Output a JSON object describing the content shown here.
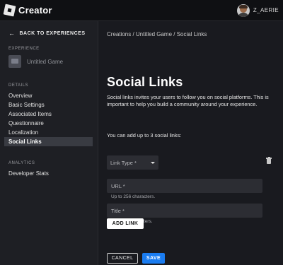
{
  "topbar": {
    "app_name": "Creator",
    "username": "Z_AERIE"
  },
  "sidebar": {
    "back_label": "BACK TO EXPERIENCES",
    "experience_section": "EXPERIENCE",
    "game_name": "Untitled Game",
    "details_section": "DETAILS",
    "details_items": [
      {
        "label": "Overview"
      },
      {
        "label": "Basic Settings"
      },
      {
        "label": "Associated Items"
      },
      {
        "label": "Questionnaire"
      },
      {
        "label": "Localization"
      },
      {
        "label": "Social Links",
        "active": true
      }
    ],
    "analytics_section": "ANALYTICS",
    "analytics_items": [
      {
        "label": "Developer Stats"
      }
    ]
  },
  "main": {
    "breadcrumb": "Creations / Untitled Game / Social Links",
    "title": "Social Links",
    "description": "Social links invites your users to follow you on social platforms. This is important to help you build a community around your experience.",
    "limit_text": "You can add up to 3 social links:",
    "link_type_label": "Link Type *",
    "url_placeholder": "URL *",
    "url_hint": "Up to 256 characters.",
    "title_placeholder": "Title *",
    "title_hint": "Up to 70 characters.",
    "add_link_label": "ADD LINK",
    "cancel_label": "CANCEL",
    "save_label": "SAVE"
  },
  "colors": {
    "background": "#191a1f",
    "sidebar": "#1e1f24",
    "field": "#2c2d33",
    "accent": "#1a7cf0"
  },
  "icons": [
    "roblox-logo-icon",
    "avatar",
    "back-arrow-icon",
    "chevron-down-icon",
    "trash-icon"
  ]
}
